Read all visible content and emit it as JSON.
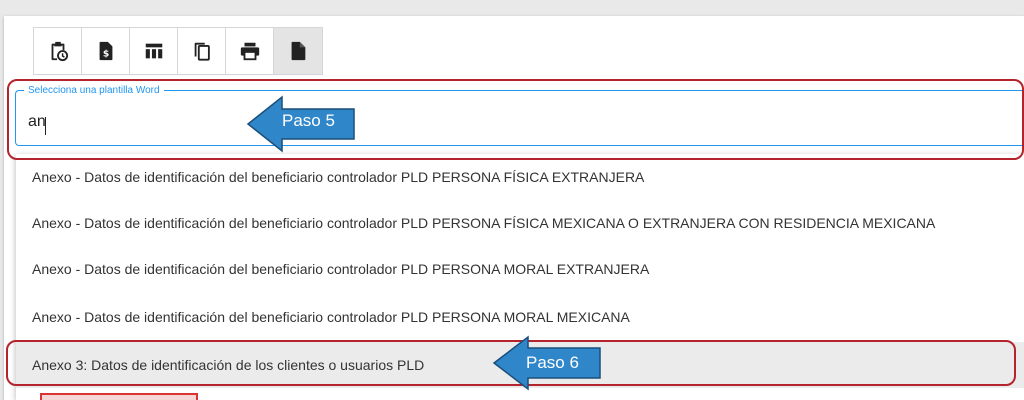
{
  "toolbar": {
    "buttons": [
      {
        "name": "clipboard-clock-icon",
        "active": false
      },
      {
        "name": "dollar-document-icon",
        "active": false
      },
      {
        "name": "table-columns-icon",
        "active": false
      },
      {
        "name": "copy-icon",
        "active": false
      },
      {
        "name": "print-icon",
        "active": false
      },
      {
        "name": "document-icon",
        "active": true
      }
    ]
  },
  "template_field": {
    "label": "Selecciona una plantilla Word",
    "value": "an"
  },
  "options": [
    {
      "label": "Anexo - Datos de identificación del beneficiario controlador PLD PERSONA FÍSICA EXTRANJERA",
      "highlighted": false
    },
    {
      "label": "Anexo - Datos de identificación del beneficiario controlador PLD PERSONA FÍSICA MEXICANA O EXTRANJERA CON RESIDENCIA MEXICANA",
      "highlighted": false
    },
    {
      "label": "Anexo - Datos de identificación del beneficiario controlador PLD PERSONA MORAL EXTRANJERA",
      "highlighted": false
    },
    {
      "label": "Anexo - Datos de identificación del beneficiario controlador PLD PERSONA MORAL MEXICANA",
      "highlighted": false
    },
    {
      "label": "Anexo 3: Datos de identificación de los clientes o usuarios PLD",
      "highlighted": true
    }
  ],
  "annotations": {
    "step_field": "Paso 5",
    "step_option": "Paso 6",
    "box_color": "#b3242c",
    "arrow_color": "#2f86c9"
  },
  "colors": {
    "accent": "#2196f3",
    "highlight": "#ebebeb"
  }
}
